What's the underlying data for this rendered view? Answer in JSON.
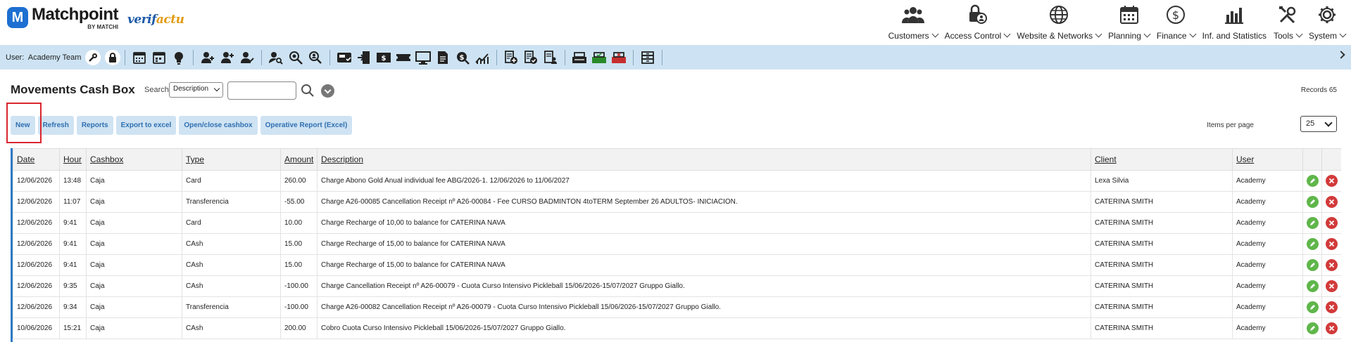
{
  "brand": {
    "name": "Matchpoint",
    "badge": "M",
    "by": "BY MATCHI",
    "verifactu_a": "verif",
    "verifactu_b": "actu"
  },
  "nav": [
    {
      "id": "customers",
      "label": "Customers",
      "icon": "customers-icon"
    },
    {
      "id": "access-control",
      "label": "Access Control",
      "icon": "lock-user-icon"
    },
    {
      "id": "website-networks",
      "label": "Website & Networks",
      "icon": "globe-icon"
    },
    {
      "id": "planning",
      "label": "Planning",
      "icon": "calendar-icon"
    },
    {
      "id": "finance",
      "label": "Finance",
      "icon": "dollar-icon"
    },
    {
      "id": "inf-statistics",
      "label": "Inf. and Statistics",
      "icon": "bar-chart-icon"
    },
    {
      "id": "tools",
      "label": "Tools",
      "icon": "tools-icon"
    },
    {
      "id": "system",
      "label": "System",
      "icon": "gear-icon"
    }
  ],
  "toolbar": {
    "user_prefix": "User:",
    "user_name": "Academy Team"
  },
  "page": {
    "title": "Movements Cash Box",
    "search_label": "Search",
    "search_field": "Description",
    "search_value": "",
    "records_label": "Records 65",
    "items_per_page_label": "Items per page",
    "items_per_page": "25"
  },
  "actions": {
    "new": "New",
    "refresh": "Refresh",
    "reports": "Reports",
    "export": "Export to excel",
    "openclose": "Open/close cashbox",
    "operative": "Operative Report (Excel)"
  },
  "table": {
    "headers": {
      "date": "Date",
      "hour": "Hour",
      "cashbox": "Cashbox",
      "type": "Type",
      "amount": "Amount",
      "description": "Description",
      "client": "Client",
      "user": "User"
    },
    "rows": [
      {
        "date": "12/06/2026",
        "hour": "13:48",
        "cashbox": "Caja",
        "type": "Card",
        "amount": "260.00",
        "description": "Charge Abono Gold Anual individual fee ABG/2026-1. 12/06/2026 to 11/06/2027",
        "client": "Lexa Silvia",
        "user": "Academy"
      },
      {
        "date": "12/06/2026",
        "hour": "11:07",
        "cashbox": "Caja",
        "type": "Transferencia",
        "amount": "-55.00",
        "description": "Charge A26-00085 Cancellation Receipt nº A26-00084 - Fee CURSO BADMINTON 4toTERM September 26 ADULTOS- INICIACION.",
        "client": "CATERINA SMITH",
        "user": "Academy"
      },
      {
        "date": "12/06/2026",
        "hour": "9:41",
        "cashbox": "Caja",
        "type": "Card",
        "amount": "10.00",
        "description": "Charge Recharge of 10,00 to balance for CATERINA NAVA",
        "client": "CATERINA SMITH",
        "user": "Academy"
      },
      {
        "date": "12/06/2026",
        "hour": "9:41",
        "cashbox": "Caja",
        "type": "CAsh",
        "amount": "15.00",
        "description": "Charge Recharge of 15,00 to balance for CATERINA NAVA",
        "client": "CATERINA SMITH",
        "user": "Academy"
      },
      {
        "date": "12/06/2026",
        "hour": "9:41",
        "cashbox": "Caja",
        "type": "CAsh",
        "amount": "15.00",
        "description": "Charge Recharge of 15,00 to balance for CATERINA NAVA",
        "client": "CATERINA SMITH",
        "user": "Academy"
      },
      {
        "date": "12/06/2026",
        "hour": "9:35",
        "cashbox": "Caja",
        "type": "CAsh",
        "amount": "-100.00",
        "description": "Charge Cancellation Receipt nº A26-00079 - Cuota Curso Intensivo Pickleball 15/06/2026-15/07/2027 Gruppo Giallo.",
        "client": "CATERINA SMITH",
        "user": "Academy"
      },
      {
        "date": "12/06/2026",
        "hour": "9:34",
        "cashbox": "Caja",
        "type": "Transferencia",
        "amount": "-100.00",
        "description": "Charge A26-00082 Cancellation Receipt nº A26-00079 - Cuota Curso Intensivo Pickleball 15/06/2026-15/07/2027 Gruppo Giallo.",
        "client": "CATERINA SMITH",
        "user": "Academy"
      },
      {
        "date": "10/06/2026",
        "hour": "15:21",
        "cashbox": "Caja",
        "type": "CAsh",
        "amount": "200.00",
        "description": "Cobro Cuota Curso Intensivo Pickleball 15/06/2026-15/07/2027 Gruppo Giallo.",
        "client": "CATERINA SMITH",
        "user": "Academy"
      }
    ]
  }
}
